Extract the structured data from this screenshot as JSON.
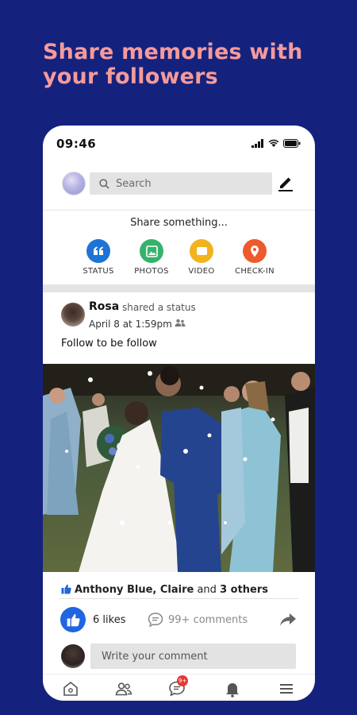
{
  "headline": "Share memories with your followers",
  "status_bar": {
    "time": "09:46"
  },
  "topbar": {
    "search_placeholder": "Search"
  },
  "share": {
    "title": "Share something...",
    "items": [
      {
        "label": "STATUS",
        "icon": "quote-icon",
        "color": "#1e73d6"
      },
      {
        "label": "PHOTOS",
        "icon": "photos-icon",
        "color": "#35b36b"
      },
      {
        "label": "VIDEO",
        "icon": "video-icon",
        "color": "#f2b31f"
      },
      {
        "label": "CHECK-IN",
        "icon": "location-pin-icon",
        "color": "#ee5a2b"
      }
    ]
  },
  "post": {
    "author": "Rosa",
    "action": "shared a status",
    "time": "April 8 at 1:59pm",
    "text": "Follow to be follow",
    "reactions": {
      "names": "Anthony Blue, Claire",
      "and": "and",
      "others": "3 others"
    },
    "likes": "6 likes",
    "comments": "99+ comments",
    "comment_placeholder": "Write your comment"
  },
  "nav": {
    "items": [
      "home-icon",
      "friends-icon",
      "messages-icon",
      "notifications-icon",
      "menu-icon"
    ],
    "messages_badge": "9+"
  },
  "colors": {
    "background": "#14227e",
    "headline": "#f59a9a",
    "accent": "#1f66e0"
  }
}
